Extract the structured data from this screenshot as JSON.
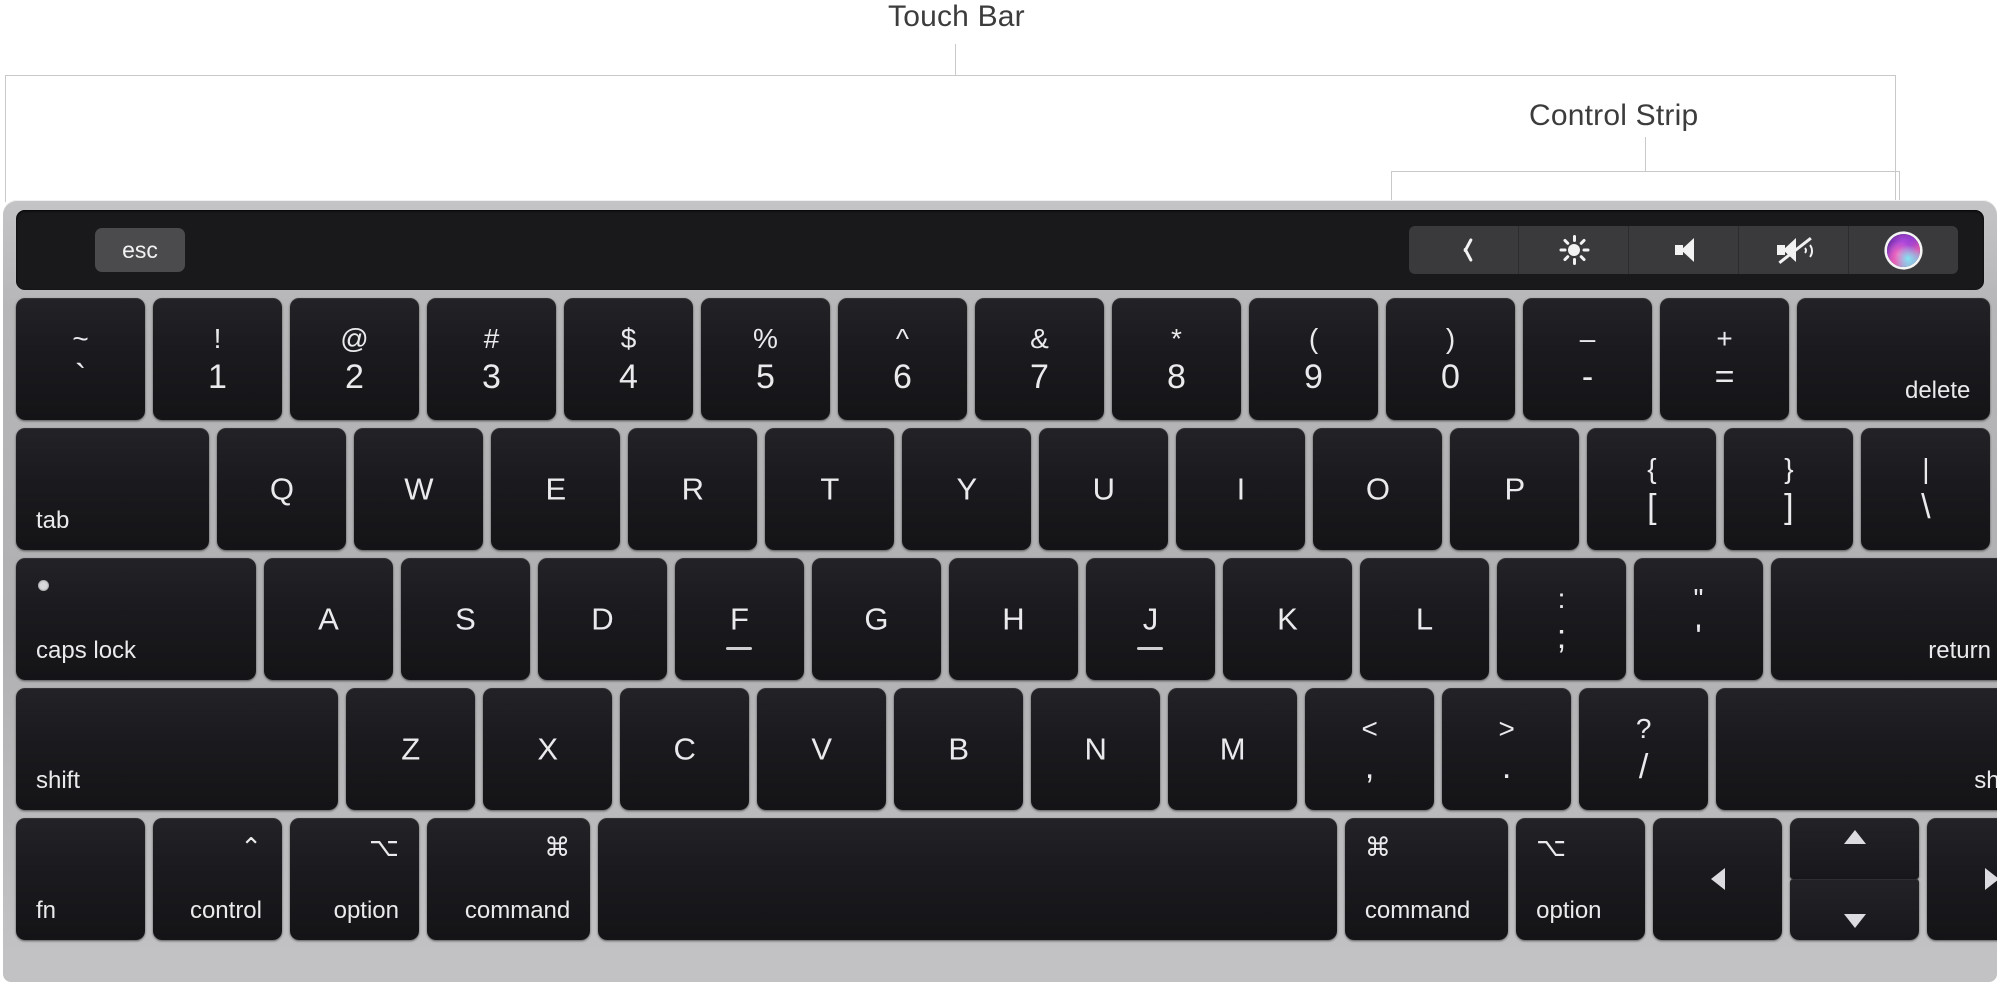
{
  "annotations": {
    "touch_bar_label": "Touch Bar",
    "control_strip_label": "Control Strip"
  },
  "touch_bar": {
    "esc_label": "esc",
    "control_strip": {
      "items": [
        {
          "icon": "chevron-left-icon",
          "name": "expand-control-strip"
        },
        {
          "icon": "brightness-icon",
          "name": "brightness"
        },
        {
          "icon": "volume-up-icon",
          "name": "volume-up"
        },
        {
          "icon": "mute-icon",
          "name": "mute"
        },
        {
          "icon": "siri-icon",
          "name": "siri"
        }
      ]
    }
  },
  "colors": {
    "chassis": "#b4b4b6",
    "key_face": "#1b1b1f",
    "touch_bar_bg": "#19191b",
    "esc_key_bg": "#4b4b4e",
    "control_strip_bg": "#3a3a3d",
    "legend_text": "#eaeaec",
    "annotation_text": "#3c3c3c",
    "leader_line": "#c9c9c9"
  },
  "rows": {
    "numbers": [
      {
        "name": "key-grave",
        "type": "dual",
        "top": "~",
        "bottom": "`",
        "units": 1
      },
      {
        "name": "key-1",
        "type": "dual",
        "top": "!",
        "bottom": "1",
        "units": 1
      },
      {
        "name": "key-2",
        "type": "dual",
        "top": "@",
        "bottom": "2",
        "units": 1
      },
      {
        "name": "key-3",
        "type": "dual",
        "top": "#",
        "bottom": "3",
        "units": 1
      },
      {
        "name": "key-4",
        "type": "dual",
        "top": "$",
        "bottom": "4",
        "units": 1
      },
      {
        "name": "key-5",
        "type": "dual",
        "top": "%",
        "bottom": "5",
        "units": 1
      },
      {
        "name": "key-6",
        "type": "dual",
        "top": "^",
        "bottom": "6",
        "units": 1
      },
      {
        "name": "key-7",
        "type": "dual",
        "top": "&",
        "bottom": "7",
        "units": 1
      },
      {
        "name": "key-8",
        "type": "dual",
        "top": "*",
        "bottom": "8",
        "units": 1
      },
      {
        "name": "key-9",
        "type": "dual",
        "top": "(",
        "bottom": "9",
        "units": 1
      },
      {
        "name": "key-0",
        "type": "dual",
        "top": ")",
        "bottom": "0",
        "units": 1
      },
      {
        "name": "key-minus",
        "type": "dual",
        "top": "–",
        "bottom": "-",
        "units": 1
      },
      {
        "name": "key-equals",
        "type": "dual",
        "top": "+",
        "bottom": "=",
        "units": 1
      },
      {
        "name": "key-delete",
        "type": "word-br",
        "label": "delete",
        "units": 1.47
      }
    ],
    "tab": [
      {
        "name": "key-tab",
        "type": "word-bl",
        "label": "tab",
        "units": 1.47
      },
      {
        "name": "key-q",
        "type": "letter",
        "label": "Q",
        "units": 1
      },
      {
        "name": "key-w",
        "type": "letter",
        "label": "W",
        "units": 1
      },
      {
        "name": "key-e",
        "type": "letter",
        "label": "E",
        "units": 1
      },
      {
        "name": "key-r",
        "type": "letter",
        "label": "R",
        "units": 1
      },
      {
        "name": "key-t",
        "type": "letter",
        "label": "T",
        "units": 1
      },
      {
        "name": "key-y",
        "type": "letter",
        "label": "Y",
        "units": 1
      },
      {
        "name": "key-u",
        "type": "letter",
        "label": "U",
        "units": 1
      },
      {
        "name": "key-i",
        "type": "letter",
        "label": "I",
        "units": 1
      },
      {
        "name": "key-o",
        "type": "letter",
        "label": "O",
        "units": 1
      },
      {
        "name": "key-p",
        "type": "letter",
        "label": "P",
        "units": 1
      },
      {
        "name": "key-leftbracket",
        "type": "dual",
        "top": "{",
        "bottom": "[",
        "units": 1
      },
      {
        "name": "key-rightbracket",
        "type": "dual",
        "top": "}",
        "bottom": "]",
        "units": 1
      },
      {
        "name": "key-backslash",
        "type": "dual",
        "top": "|",
        "bottom": "\\",
        "units": 1
      }
    ],
    "caps": [
      {
        "name": "key-capslock",
        "type": "capslock",
        "label": "caps lock",
        "units": 1.81
      },
      {
        "name": "key-a",
        "type": "letter",
        "label": "A",
        "units": 1
      },
      {
        "name": "key-s",
        "type": "letter",
        "label": "S",
        "units": 1
      },
      {
        "name": "key-d",
        "type": "letter",
        "label": "D",
        "units": 1
      },
      {
        "name": "key-f",
        "type": "letter",
        "label": "F",
        "units": 1,
        "bump": true
      },
      {
        "name": "key-g",
        "type": "letter",
        "label": "G",
        "units": 1
      },
      {
        "name": "key-h",
        "type": "letter",
        "label": "H",
        "units": 1
      },
      {
        "name": "key-j",
        "type": "letter",
        "label": "J",
        "units": 1,
        "bump": true
      },
      {
        "name": "key-k",
        "type": "letter",
        "label": "K",
        "units": 1
      },
      {
        "name": "key-l",
        "type": "letter",
        "label": "L",
        "units": 1
      },
      {
        "name": "key-semicolon",
        "type": "dual",
        "top": ":",
        "bottom": ";",
        "units": 1
      },
      {
        "name": "key-quote",
        "type": "dual",
        "top": "\"",
        "bottom": "'",
        "units": 1
      },
      {
        "name": "key-return",
        "type": "word-br",
        "label": "return",
        "units": 1.81
      }
    ],
    "shift": [
      {
        "name": "key-leftshift",
        "type": "word-bl",
        "label": "shift",
        "units": 2.41
      },
      {
        "name": "key-z",
        "type": "letter",
        "label": "Z",
        "units": 1
      },
      {
        "name": "key-x",
        "type": "letter",
        "label": "X",
        "units": 1
      },
      {
        "name": "key-c",
        "type": "letter",
        "label": "C",
        "units": 1
      },
      {
        "name": "key-v",
        "type": "letter",
        "label": "V",
        "units": 1
      },
      {
        "name": "key-b",
        "type": "letter",
        "label": "B",
        "units": 1
      },
      {
        "name": "key-n",
        "type": "letter",
        "label": "N",
        "units": 1
      },
      {
        "name": "key-m",
        "type": "letter",
        "label": "M",
        "units": 1
      },
      {
        "name": "key-comma",
        "type": "dual",
        "top": "<",
        "bottom": ",",
        "units": 1
      },
      {
        "name": "key-period",
        "type": "dual",
        "top": ">",
        "bottom": ".",
        "units": 1
      },
      {
        "name": "key-slash",
        "type": "dual",
        "top": "?",
        "bottom": "/",
        "units": 1
      },
      {
        "name": "key-rightshift",
        "type": "word-br",
        "label": "shift",
        "units": 2.41
      }
    ],
    "bottom": [
      {
        "name": "key-fn",
        "type": "word-bl",
        "label": "fn",
        "units": 1
      },
      {
        "name": "key-leftcontrol",
        "type": "mod-right",
        "symbol": "⌃",
        "label": "control",
        "units": 1
      },
      {
        "name": "key-leftoption",
        "type": "mod-right",
        "symbol": "⌥",
        "label": "option",
        "units": 1
      },
      {
        "name": "key-leftcommand",
        "type": "mod-right",
        "symbol": "⌘",
        "label": "command",
        "units": 1.25
      },
      {
        "name": "key-space",
        "type": "blank",
        "label": "",
        "units": 5.45
      },
      {
        "name": "key-rightcommand",
        "type": "mod-left",
        "symbol": "⌘",
        "label": "command",
        "units": 1.25
      },
      {
        "name": "key-rightoption",
        "type": "mod-left",
        "symbol": "⌥",
        "label": "option",
        "units": 1
      }
    ],
    "arrows": [
      {
        "name": "key-arrow-left",
        "icon": "arrow-left-icon"
      },
      {
        "name": "key-arrow-up",
        "icon": "arrow-up-icon"
      },
      {
        "name": "key-arrow-down",
        "icon": "arrow-down-icon"
      },
      {
        "name": "key-arrow-right",
        "icon": "arrow-right-icon"
      }
    ]
  }
}
